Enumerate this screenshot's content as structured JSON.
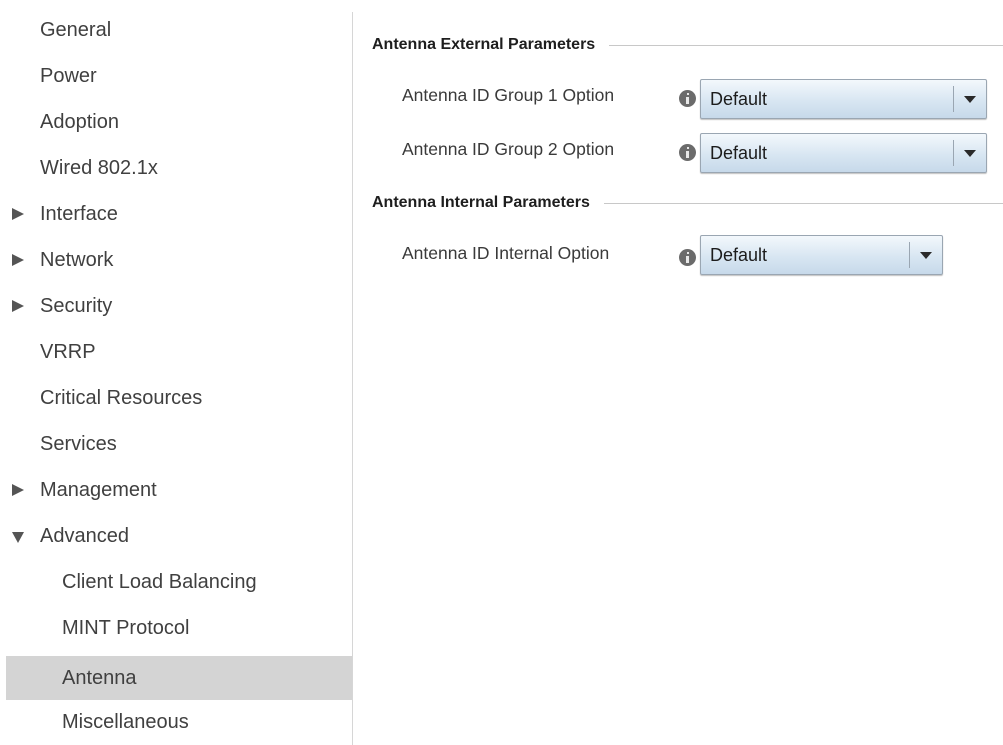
{
  "sidebar": {
    "items": [
      {
        "label": "General"
      },
      {
        "label": "Power"
      },
      {
        "label": "Adoption"
      },
      {
        "label": "Wired 802.1x"
      },
      {
        "label": "Interface"
      },
      {
        "label": "Network"
      },
      {
        "label": "Security"
      },
      {
        "label": "VRRP"
      },
      {
        "label": "Critical Resources"
      },
      {
        "label": "Services"
      },
      {
        "label": "Management"
      },
      {
        "label": "Advanced"
      },
      {
        "label": "Client Load Balancing"
      },
      {
        "label": "MINT Protocol"
      },
      {
        "label": "Antenna"
      },
      {
        "label": "Miscellaneous"
      }
    ],
    "selected": "Antenna",
    "icons": {
      "collapsed": "triangle-right-icon",
      "expanded": "triangle-down-icon"
    }
  },
  "main": {
    "external": {
      "title": "Antenna External Parameters",
      "fields": [
        {
          "label": "Antenna ID Group 1 Option",
          "value": "Default",
          "icon": "info-icon"
        },
        {
          "label": "Antenna ID Group 2 Option",
          "value": "Default",
          "icon": "info-icon"
        }
      ]
    },
    "internal": {
      "title": "Antenna Internal Parameters",
      "fields": [
        {
          "label": "Antenna ID Internal Option",
          "value": "Default",
          "icon": "info-icon"
        }
      ]
    }
  },
  "colors": {
    "selected_background": "#d4d4d4",
    "select_gradient_top": "#f3f8fc",
    "select_gradient_bottom": "#c7d9ea",
    "info_icon": "#6b6b6b"
  }
}
